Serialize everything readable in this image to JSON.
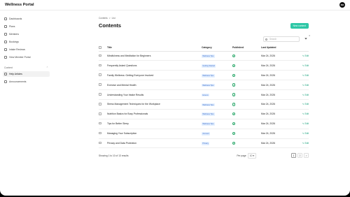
{
  "app": {
    "title": "Wellness Portal",
    "avatar_initials": "NO"
  },
  "sidebar": {
    "items": [
      {
        "label": "Dashboards",
        "icon": "dashboard-icon"
      },
      {
        "label": "Plans",
        "icon": "plans-icon"
      },
      {
        "label": "Members",
        "icon": "members-icon"
      },
      {
        "label": "Bookings",
        "icon": "bookings-icon"
      },
      {
        "label": "Intake Reviews",
        "icon": "reviews-icon"
      },
      {
        "label": "View Member Portal",
        "icon": "portal-icon"
      }
    ],
    "section": {
      "label": "Content",
      "items": [
        {
          "label": "Help Articles",
          "icon": "article-icon",
          "active": true
        },
        {
          "label": "Announcements",
          "icon": "announce-icon",
          "active": false
        }
      ]
    }
  },
  "breadcrumb": {
    "parent": "Contents",
    "sep": ">",
    "current": "List"
  },
  "page": {
    "title": "Contents",
    "new_button": "New content"
  },
  "search": {
    "placeholder": "Search"
  },
  "filter": {
    "badge": "0"
  },
  "table": {
    "headers": {
      "title": "Title",
      "category": "Category",
      "published": "Published",
      "updated": "Last Updated"
    },
    "edit_label": "Edit",
    "rows": [
      {
        "title": "Mindfulness and Meditation for Beginners",
        "category": "Wellness Tips",
        "updated": "Mar 24, 2026"
      },
      {
        "title": "Frequently Asked Questions",
        "category": "Getting Started",
        "updated": "Mar 24, 2026"
      },
      {
        "title": "Family Wellness: Getting Everyone Involved",
        "category": "Wellness Tips",
        "updated": "Mar 24, 2026"
      },
      {
        "title": "Exercise and Mental Health",
        "category": "Wellness Tips",
        "updated": "Mar 24, 2026"
      },
      {
        "title": "Understanding Your Intake Results",
        "category": "How-to",
        "updated": "Mar 24, 2026"
      },
      {
        "title": "Stress Management Techniques for the Workplace",
        "category": "Wellness Tips",
        "updated": "Mar 24, 2026"
      },
      {
        "title": "Nutrition Basics for Busy Professionals",
        "category": "Wellness Tips",
        "updated": "Mar 24, 2026"
      },
      {
        "title": "Tips for Better Sleep",
        "category": "Wellness Tips",
        "updated": "Mar 24, 2026"
      },
      {
        "title": "Managing Your Subscription",
        "category": "Account",
        "updated": "Mar 24, 2026"
      },
      {
        "title": "Privacy and Data Protection",
        "category": "Privacy",
        "updated": "Mar 24, 2026"
      }
    ]
  },
  "footer": {
    "results": "Showing 1 to 10 of 13 results",
    "per_page_label": "Per page",
    "per_page_value": "10",
    "pages": [
      "1",
      "2"
    ],
    "next": ">"
  },
  "colors": {
    "accent": "#2ec7a6",
    "tag_bg": "#e3efff",
    "tag_text": "#3567c6",
    "check": "#2aa86a"
  }
}
